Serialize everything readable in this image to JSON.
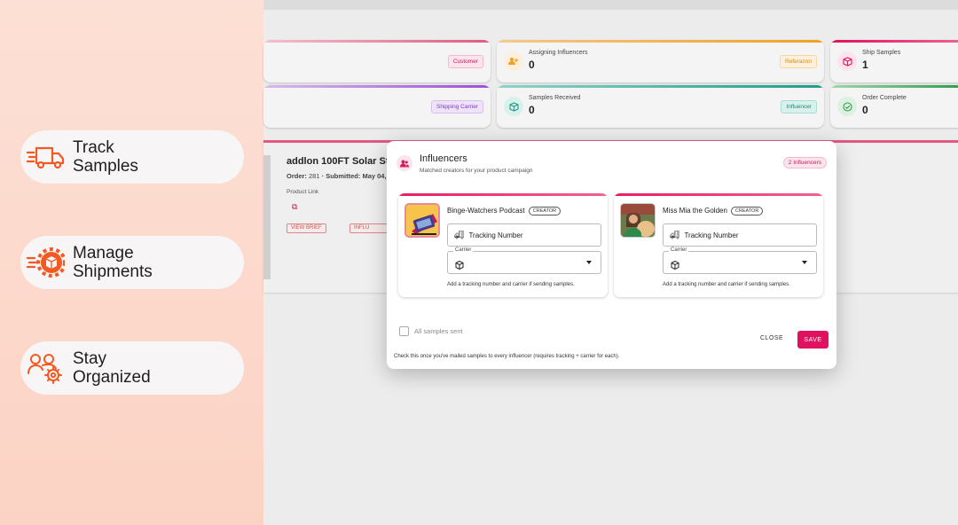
{
  "promo": {
    "items": [
      {
        "label": "Track\nSamples",
        "icon": "truck-icon"
      },
      {
        "label": "Manage\nShipments",
        "icon": "gear-box-icon"
      },
      {
        "label": "Stay\nOrganized",
        "icon": "team-gear-icon"
      }
    ],
    "accent": "#f15a22"
  },
  "stats": [
    {
      "label": "",
      "value": "",
      "chip": "Customer",
      "color": "#e05a84"
    },
    {
      "label": "Assigning Influencers",
      "value": "0",
      "chip": "Referazon",
      "color": "#f0a020"
    },
    {
      "label": "Ship Samples",
      "value": "1",
      "chip": "",
      "color": "#e0115f"
    },
    {
      "label": "",
      "value": "",
      "chip": "Shipping Carrier",
      "color": "#9c4fd6"
    },
    {
      "label": "Samples Received",
      "value": "0",
      "chip": "Influencer",
      "color": "#1b9e8a"
    },
    {
      "label": "Order Complete",
      "value": "0",
      "chip": "",
      "color": "#2e9e4a"
    }
  ],
  "product": {
    "title": "addlon 100FT Solar St",
    "order_label": "Order:",
    "order_no": "281",
    "submitted": "· Submitted: May 04,",
    "link_label": "Product Link",
    "view_brief": "VIEW BRIEF",
    "influencers_btn": "INFLU"
  },
  "modal": {
    "title": "Influencers",
    "subtitle": "Matched creators for your product campaign",
    "badge": "2 Influencers",
    "influencers": [
      {
        "name": "Binge-Watchers Podcast",
        "tag": "CREATOR",
        "tracking_placeholder": "Tracking Number",
        "carrier_label": "Carrier",
        "help": "Add a tracking number and carrier if sending samples."
      },
      {
        "name": "Miss Mia the Golden",
        "tag": "CREATOR",
        "tracking_placeholder": "Tracking Number",
        "carrier_label": "Carrier",
        "help": "Add a tracking number and carrier if sending samples."
      }
    ],
    "all_samples_label": "All samples sent",
    "note": "Check this once you've mailed samples to every influencer (requires tracking + carrier for each).",
    "close_label": "CLOSE",
    "save_label": "SAVE",
    "primary_color": "#e0115f"
  }
}
